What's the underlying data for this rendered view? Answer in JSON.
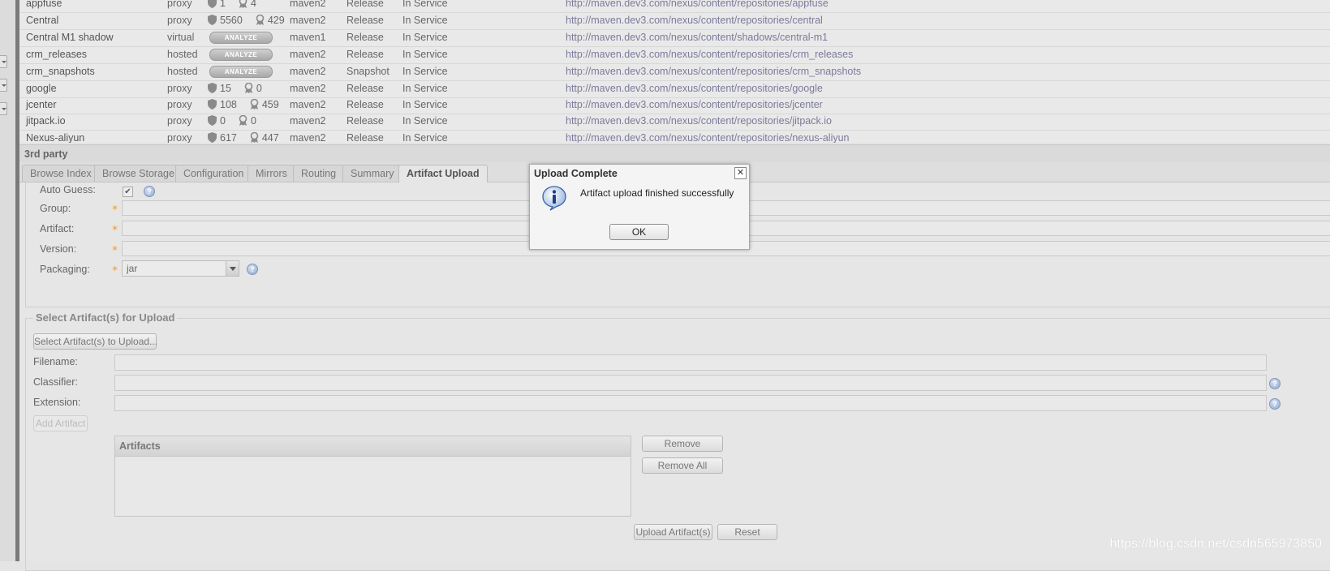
{
  "repositories": [
    {
      "name": "appfuse",
      "type": "proxy",
      "health": {
        "kind": "counts",
        "security": "1",
        "license": "4"
      },
      "format": "maven2",
      "policy": "Release",
      "status": "In Service",
      "url": "http://maven.dev3.com/nexus/content/repositories/appfuse"
    },
    {
      "name": "Central",
      "type": "proxy",
      "health": {
        "kind": "counts",
        "security": "5560",
        "license": "429"
      },
      "format": "maven2",
      "policy": "Release",
      "status": "In Service",
      "url": "http://maven.dev3.com/nexus/content/repositories/central"
    },
    {
      "name": "Central M1 shadow",
      "type": "virtual",
      "health": {
        "kind": "analyze",
        "label": "ANALYZE"
      },
      "format": "maven1",
      "policy": "Release",
      "status": "In Service",
      "url": "http://maven.dev3.com/nexus/content/shadows/central-m1"
    },
    {
      "name": "crm_releases",
      "type": "hosted",
      "health": {
        "kind": "analyze",
        "label": "ANALYZE"
      },
      "format": "maven2",
      "policy": "Release",
      "status": "In Service",
      "url": "http://maven.dev3.com/nexus/content/repositories/crm_releases"
    },
    {
      "name": "crm_snapshots",
      "type": "hosted",
      "health": {
        "kind": "analyze",
        "label": "ANALYZE"
      },
      "format": "maven2",
      "policy": "Snapshot",
      "status": "In Service",
      "url": "http://maven.dev3.com/nexus/content/repositories/crm_snapshots"
    },
    {
      "name": "google",
      "type": "proxy",
      "health": {
        "kind": "counts",
        "security": "15",
        "license": "0"
      },
      "format": "maven2",
      "policy": "Release",
      "status": "In Service",
      "url": "http://maven.dev3.com/nexus/content/repositories/google"
    },
    {
      "name": "jcenter",
      "type": "proxy",
      "health": {
        "kind": "counts",
        "security": "108",
        "license": "459"
      },
      "format": "maven2",
      "policy": "Release",
      "status": "In Service",
      "url": "http://maven.dev3.com/nexus/content/repositories/jcenter"
    },
    {
      "name": "jitpack.io",
      "type": "proxy",
      "health": {
        "kind": "counts",
        "security": "0",
        "license": "0"
      },
      "format": "maven2",
      "policy": "Release",
      "status": "In Service",
      "url": "http://maven.dev3.com/nexus/content/repositories/jitpack.io"
    },
    {
      "name": "Nexus-aliyun",
      "type": "proxy",
      "health": {
        "kind": "counts",
        "security": "617",
        "license": "447"
      },
      "format": "maven2",
      "policy": "Release",
      "status": "In Service",
      "url": "http://maven.dev3.com/nexus/content/repositories/nexus-aliyun"
    }
  ],
  "panel": {
    "title": "3rd party",
    "tabs": [
      "Browse Index",
      "Browse Storage",
      "Configuration",
      "Mirrors",
      "Routing",
      "Summary",
      "Artifact Upload"
    ],
    "active_tab": "Artifact Upload"
  },
  "gav": {
    "auto_guess_label": "Auto Guess:",
    "auto_guess_checked": true,
    "group_label": "Group:",
    "group_value": "",
    "artifact_label": "Artifact:",
    "artifact_value": "",
    "version_label": "Version:",
    "version_value": "",
    "packaging_label": "Packaging:",
    "packaging_value": "jar"
  },
  "upload": {
    "legend": "Select Artifact(s) for Upload",
    "select_button": "Select Artifact(s) to Upload...",
    "filename_label": "Filename:",
    "classifier_label": "Classifier:",
    "extension_label": "Extension:",
    "add_artifact_button": "Add Artifact",
    "artifacts_header": "Artifacts",
    "remove_button": "Remove",
    "remove_all_button": "Remove All",
    "upload_button": "Upload Artifact(s)",
    "reset_button": "Reset"
  },
  "dialog": {
    "title": "Upload Complete",
    "message": "Artifact upload finished successfully",
    "ok_label": "OK",
    "close_glyph": "✕",
    "icon": "info-icon"
  },
  "watermark": "https://blog.csdn.net/csdn565973850",
  "colors": {
    "required_star": "#f0a84a",
    "url_text": "#7b7b9c"
  }
}
